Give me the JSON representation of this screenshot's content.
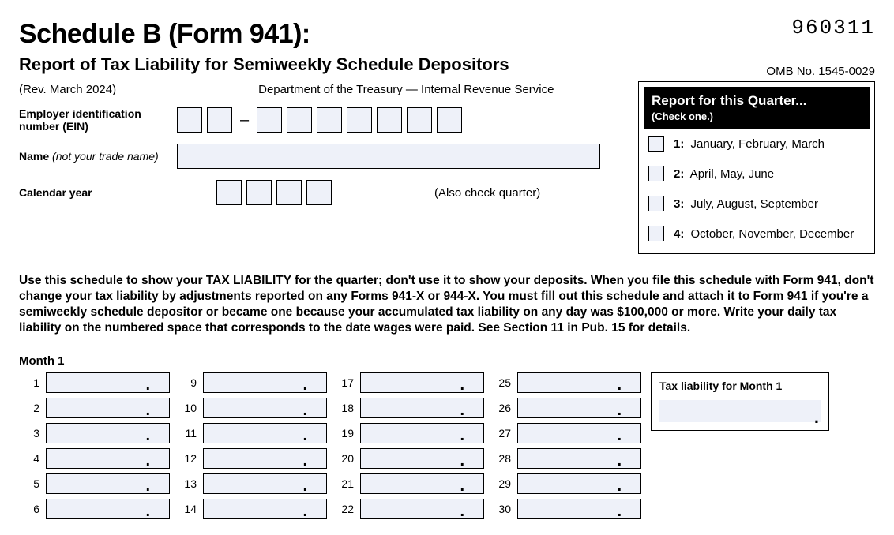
{
  "header": {
    "title": "Schedule B (Form 941):",
    "code": "960311",
    "subtitle": "Report of Tax Liability for Semiweekly Schedule Depositors",
    "omb": "OMB No. 1545-0029",
    "rev": "(Rev. March 2024)",
    "dept": "Department of the Treasury — Internal Revenue Service"
  },
  "fields": {
    "ein_label": "Employer identification number (EIN)",
    "name_label_bold": "Name",
    "name_label_italic": " (not your trade name)",
    "year_label": "Calendar year",
    "also_check": "(Also check quarter)"
  },
  "quarter_box": {
    "title": "Report for this Quarter...",
    "sub": "(Check one.)",
    "options": [
      {
        "num": "1:",
        "label": " January, February, March"
      },
      {
        "num": "2:",
        "label": " April, May, June"
      },
      {
        "num": "3:",
        "label": " July, August, September"
      },
      {
        "num": "4:",
        "label": " October, November, December"
      }
    ]
  },
  "instruction": "Use this schedule to show your TAX LIABILITY for the quarter; don't use it to show your deposits. When you file this schedule with Form 941, don't change your tax liability by adjustments reported on any Forms 941-X or 944-X. You must fill out this schedule and attach it to Form 941 if you're a semiweekly schedule depositor or became one because your accumulated tax liability on any day was $100,000 or more. Write your daily tax liability on the numbered space that corresponds to the date wages were paid. See Section 11 in Pub. 15 for details.",
  "month1": {
    "label": "Month 1",
    "total_label": "Tax liability for Month 1",
    "days_col1": [
      "1",
      "2",
      "3",
      "4",
      "5",
      "6"
    ],
    "days_col2": [
      "9",
      "10",
      "11",
      "12",
      "13",
      "14"
    ],
    "days_col3": [
      "17",
      "18",
      "19",
      "20",
      "21",
      "22"
    ],
    "days_col4": [
      "25",
      "26",
      "27",
      "28",
      "29",
      "30"
    ]
  }
}
